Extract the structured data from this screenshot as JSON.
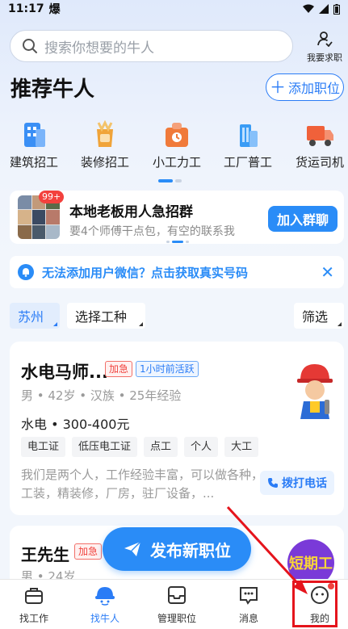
{
  "status_bar": {
    "time": "11:17",
    "flame": "爆"
  },
  "search": {
    "placeholder": "搜索你想要的牛人"
  },
  "job_seek": {
    "label": "我要求职"
  },
  "page_title": "推荐牛人",
  "add_position": {
    "label": "添加职位"
  },
  "categories": [
    {
      "label": "建筑招工",
      "icon": "building-icon",
      "color": "#3a8ff5"
    },
    {
      "label": "装修招工",
      "icon": "paint-bucket-icon",
      "color": "#f0a43a"
    },
    {
      "label": "小工力工",
      "icon": "worker-icon",
      "color": "#f07a3a"
    },
    {
      "label": "工厂普工",
      "icon": "factory-icon",
      "color": "#3a9cf5"
    },
    {
      "label": "货运司机",
      "icon": "truck-icon",
      "color": "#f0613a"
    }
  ],
  "group_card": {
    "badge": "99+",
    "title": "本地老板用人急招群",
    "subtitle": "要4个师傅干点包，有空的联系我",
    "join_label": "加入群聊"
  },
  "tip_bar": {
    "text": "无法添加用户微信？点击获取真实号码"
  },
  "filters": {
    "city": "苏州",
    "job_type": "选择工种",
    "screen": "筛选"
  },
  "cards": [
    {
      "name": "水电马师...",
      "urgent": "加急",
      "active": "1小时前活跃",
      "meta": "男 • 42岁 • 汉族 • 25年经验",
      "salary": "水电 • 300-400元",
      "skills": [
        "电工证",
        "低压电工证",
        "点工",
        "个人",
        "大工"
      ],
      "desc": "我们是两个人，工作经验丰富，可以做各种，工装，精装修，厂房，驻厂设备，...",
      "call_label": "拨打电话"
    },
    {
      "name": "王先生",
      "urgent": "加急",
      "meta": "男 • 24岁"
    }
  ],
  "short_work": "短期工",
  "publish": {
    "label": "发布新职位"
  },
  "tabs": [
    {
      "label": "找工作",
      "icon": "briefcase-icon",
      "active": false
    },
    {
      "label": "找牛人",
      "icon": "helmet-icon",
      "active": true
    },
    {
      "label": "管理职位",
      "icon": "inbox-icon",
      "active": false
    },
    {
      "label": "消息",
      "icon": "chat-icon",
      "active": false
    },
    {
      "label": "我的",
      "icon": "profile-icon",
      "active": false
    }
  ],
  "colors": {
    "primary": "#2a8cf7",
    "urgent": "#f0433e",
    "annotation": "#e5141c"
  }
}
